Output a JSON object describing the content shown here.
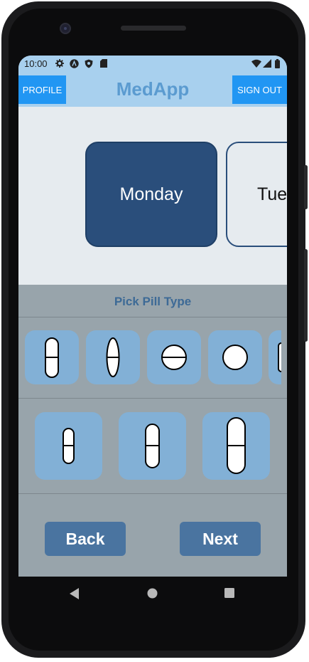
{
  "status_bar": {
    "time": "10:00",
    "left_icons": [
      "gear-icon",
      "app-circle-icon",
      "shield-icon",
      "sd-card-icon"
    ],
    "right_icons": [
      "wifi-icon",
      "signal-icon",
      "battery-icon"
    ]
  },
  "app_bar": {
    "title": "MedApp",
    "profile_label": "PROFILE",
    "sign_out_label": "SIGN OUT",
    "title_color": "#5b9bd0",
    "bar_color": "#a8d0ee",
    "button_color": "#2196f3"
  },
  "days": {
    "selected": "Monday",
    "next_partial": "Tue"
  },
  "pill_picker": {
    "heading": "Pick Pill Type",
    "shapes_row": [
      "capsule-vertical",
      "oval-vertical",
      "round-scored",
      "round",
      "partially-visible"
    ],
    "sizes_row": [
      "capsule-small",
      "capsule-medium",
      "capsule-large"
    ]
  },
  "navigation": {
    "back_label": "Back",
    "next_label": "Next"
  },
  "system_nav": [
    "back-triangle-icon",
    "home-circle-icon",
    "recents-square-icon"
  ]
}
